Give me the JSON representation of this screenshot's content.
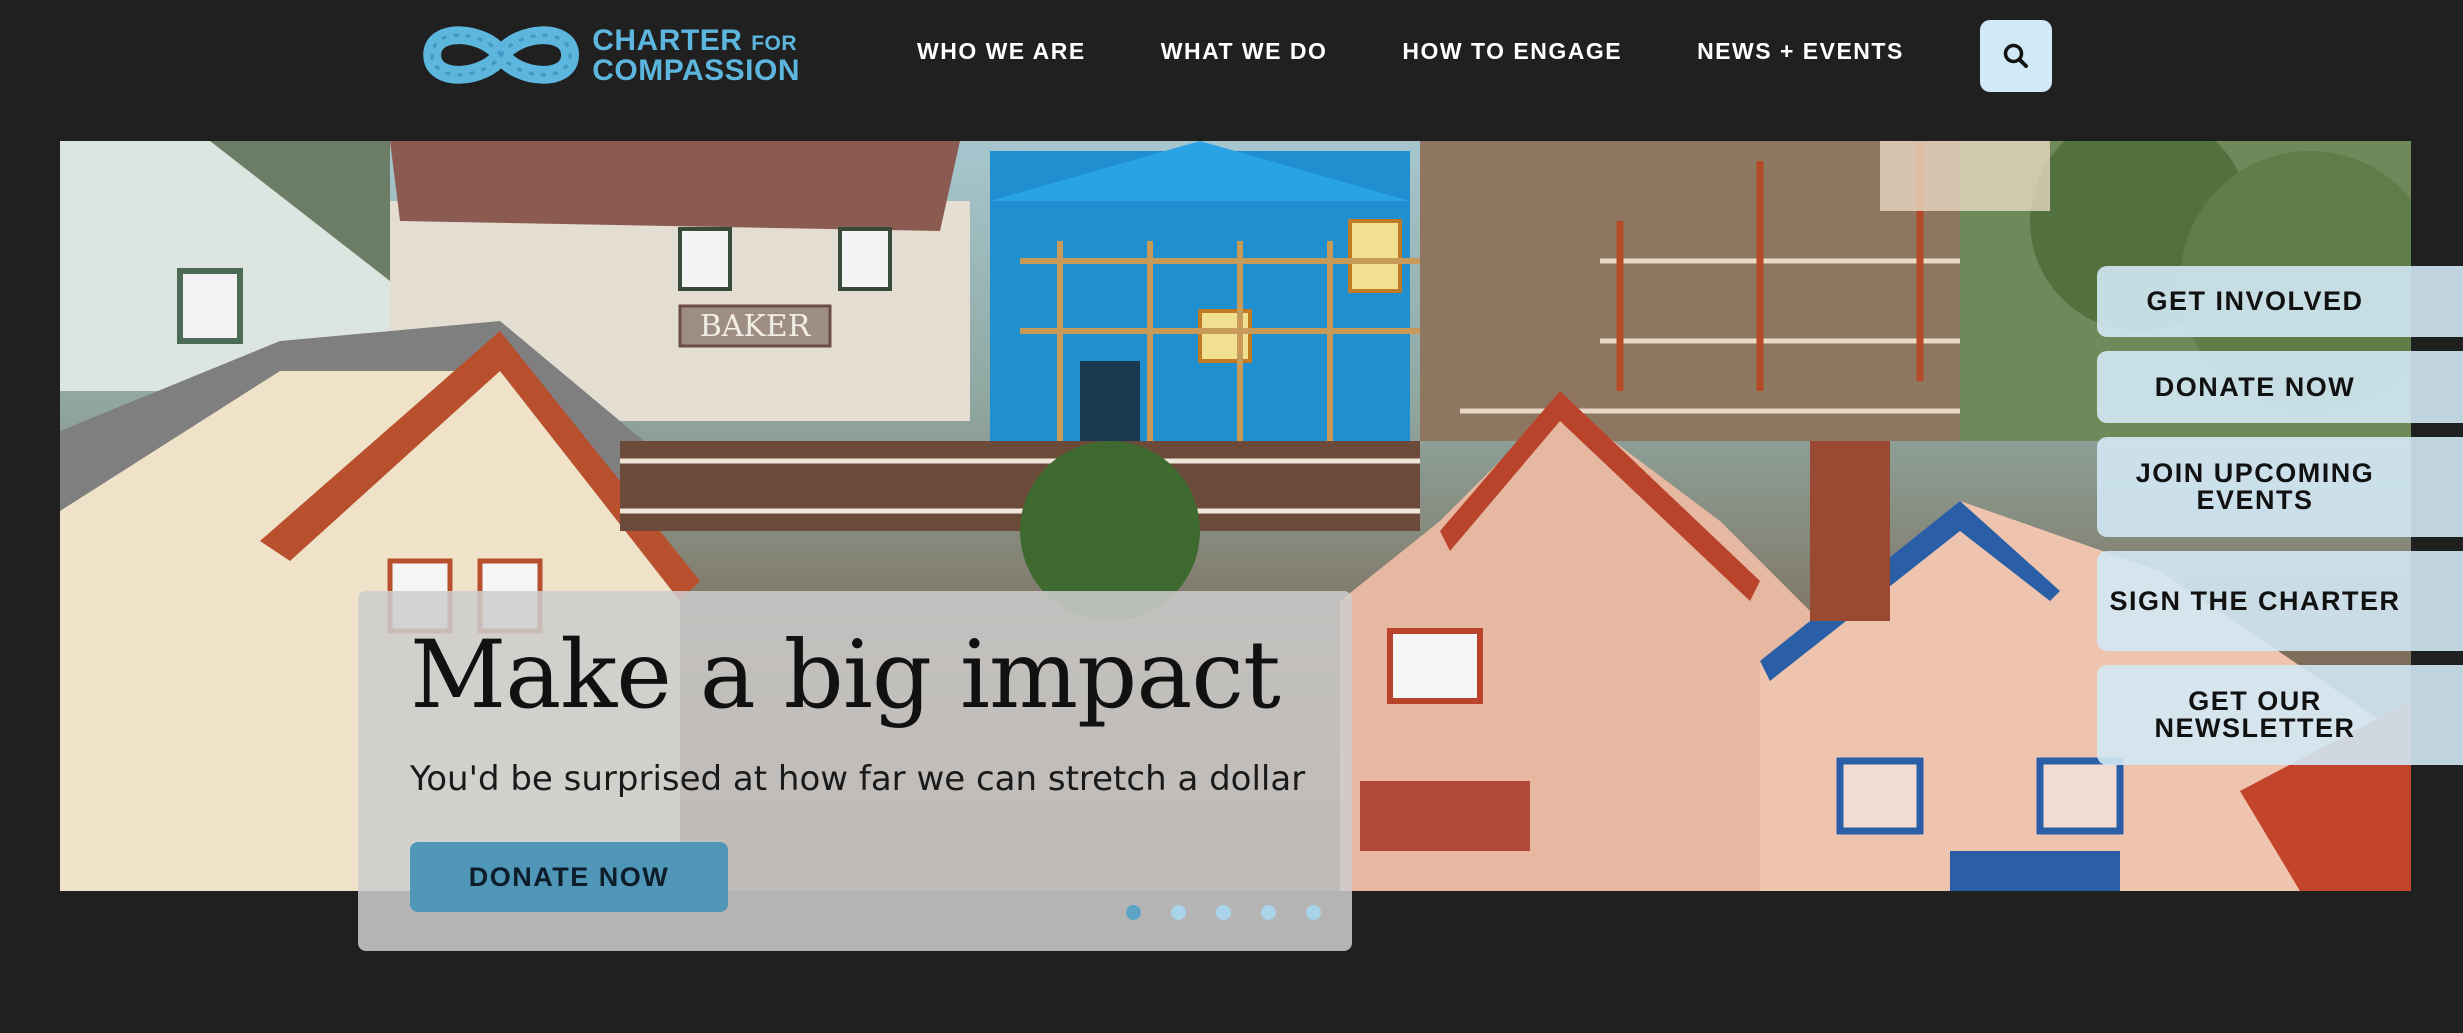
{
  "logo": {
    "line1": "CHARTER",
    "line1_small": "FOR",
    "line2": "COMPASSION",
    "color": "#5db6de"
  },
  "nav": {
    "items": [
      {
        "label": "WHO WE ARE"
      },
      {
        "label": "WHAT WE DO"
      },
      {
        "label": "HOW TO ENGAGE"
      },
      {
        "label": "NEWS + EVENTS"
      }
    ]
  },
  "search": {
    "icon": "search-icon"
  },
  "hero": {
    "image": "colorful wooden village houses",
    "sign_text": "BAKER",
    "title": "Make a big impact",
    "subtitle": "You'd be surprised at how far we can stretch a dollar",
    "cta_label": "DONATE NOW",
    "slides": 5,
    "active_slide": 1
  },
  "side_actions": [
    {
      "label": "GET INVOLVED"
    },
    {
      "label": "DONATE NOW"
    },
    {
      "label": "JOIN UPCOMING EVENTS"
    },
    {
      "label": "SIGN THE CHARTER"
    },
    {
      "label": "GET OUR NEWSLETTER"
    }
  ],
  "colors": {
    "background": "#202020",
    "accent": "#4f96b7",
    "side_bg": "#d2e8f4"
  }
}
